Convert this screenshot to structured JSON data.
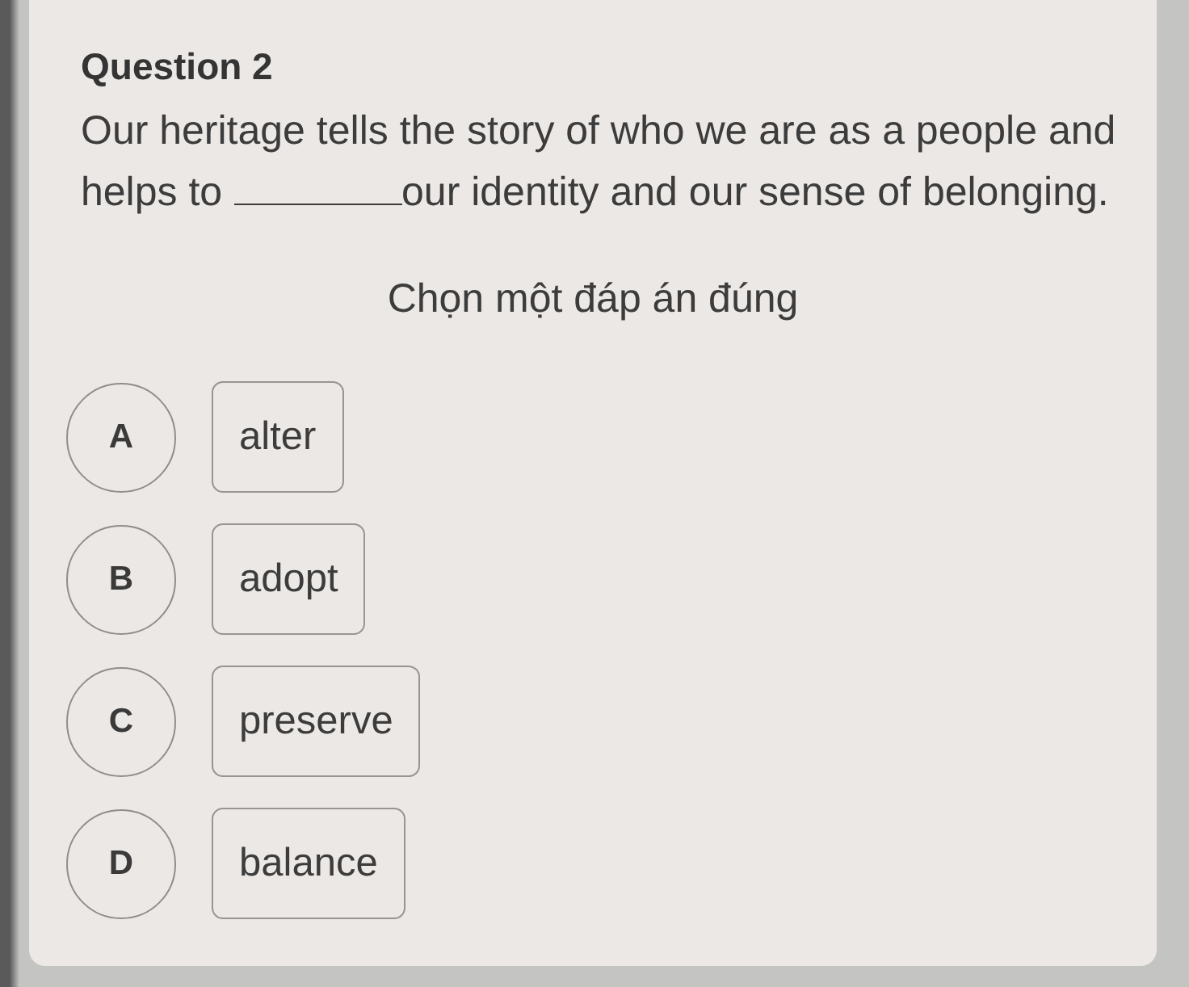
{
  "question": {
    "title": "Question 2",
    "text_before": "Our heritage tells the story of who we are as a people and helps to",
    "text_after": "our identity and our sense of belonging."
  },
  "instruction": "Chọn một đáp án đúng",
  "options": [
    {
      "letter": "A",
      "text": "alter",
      "selected": false
    },
    {
      "letter": "B",
      "text": "adopt",
      "selected": false
    },
    {
      "letter": "C",
      "text": "preserve",
      "selected": false
    },
    {
      "letter": "D",
      "text": "balance",
      "selected": false
    }
  ]
}
